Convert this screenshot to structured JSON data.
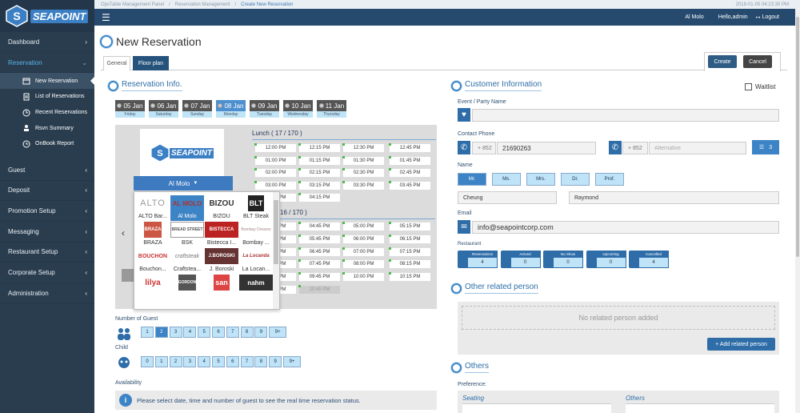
{
  "brand": {
    "logo_text": "SEAPOINT"
  },
  "topbar": {
    "crumbs": [
      "OpsTable Management Panel",
      "Reservation Management",
      "Create New Reservation"
    ],
    "datetime": "2018-01-05 04:23:30 PM"
  },
  "navbar": {
    "restaurant": "Al Molo",
    "greeting": "Hello,admin",
    "logout": "Logout"
  },
  "sidebar": {
    "dashboard": "Dashboard",
    "reservation": "Reservation",
    "sub": [
      "New Reservation",
      "List of Reservations",
      "Recent Reservations",
      "Rsvn Summary",
      "OnBook Report"
    ],
    "items": [
      "Guest",
      "Deposit",
      "Promotion Setup",
      "Messaging",
      "Restaurant Setup",
      "Corporate Setup",
      "Administration"
    ]
  },
  "page": {
    "title": "New Reservation",
    "tabs": [
      "General",
      "Floor plan"
    ],
    "create": "Create",
    "cancel": "Cancel"
  },
  "resinfo": {
    "heading": "Reservation Info."
  },
  "dates": [
    {
      "day": "05 Jan",
      "wd": "Friday"
    },
    {
      "day": "06 Jan",
      "wd": "Saturday"
    },
    {
      "day": "07 Jan",
      "wd": "Sunday"
    },
    {
      "day": "08 Jan",
      "wd": "Monday"
    },
    {
      "day": "09 Jan",
      "wd": "Tuesday"
    },
    {
      "day": "10 Jan",
      "wd": "Wednesday"
    },
    {
      "day": "11 Jan",
      "wd": "Thursday"
    }
  ],
  "restaurant_select": "Al Molo",
  "lunch": {
    "label": "Lunch ( 17 / 170 )",
    "slots": [
      "12:00 PM",
      "12:15 PM",
      "12:30 PM",
      "12:45 PM",
      "01:00 PM",
      "01:15 PM",
      "01:30 PM",
      "01:45 PM",
      "02:00 PM",
      "02:15 PM",
      "02:30 PM",
      "02:45 PM",
      "03:00 PM",
      "03:15 PM",
      "03:30 PM",
      "03:45 PM",
      "04:00 PM",
      "04:15 PM"
    ]
  },
  "dinner": {
    "label": "16 / 170 )",
    "slots": [
      "04:30 PM",
      "04:45 PM",
      "05:00 PM",
      "05:15 PM",
      "05:30 PM",
      "05:45 PM",
      "06:00 PM",
      "06:15 PM",
      "06:30 PM",
      "06:45 PM",
      "07:00 PM",
      "07:15 PM",
      "07:30 PM",
      "07:45 PM",
      "08:00 PM",
      "08:15 PM",
      "09:30 PM",
      "09:45 PM",
      "10:00 PM",
      "10:15 PM",
      "10:30 PM",
      "10:45 PM"
    ]
  },
  "restaurants": [
    {
      "logo": "ALTO",
      "name": "ALTO Bar..."
    },
    {
      "logo": "AL MOLO",
      "name": "Al Molo"
    },
    {
      "logo": "BIZOU",
      "name": "BIZOU"
    },
    {
      "logo": "BLT",
      "name": "BLT Steak"
    },
    {
      "logo": "BRAZA",
      "name": "BRAZA"
    },
    {
      "logo": "BREAD STREET",
      "name": "BSK"
    },
    {
      "logo": "BISTECCA",
      "name": "Bistecca I..."
    },
    {
      "logo": "Bombay Dreams",
      "name": "Bombay ..."
    },
    {
      "logo": "BOUCHON",
      "name": "Bouchon..."
    },
    {
      "logo": "craftsteak",
      "name": "Craftstea..."
    },
    {
      "logo": "J.BOROSKI",
      "name": "J. Boroski"
    },
    {
      "logo": "La Locanda",
      "name": "La Locan..."
    },
    {
      "logo": "lilya",
      "name": ""
    },
    {
      "logo": "GORDON",
      "name": ""
    },
    {
      "logo": "san",
      "name": ""
    },
    {
      "logo": "nahm",
      "name": ""
    }
  ],
  "guests": {
    "label": "Number of Guest",
    "values": [
      "1",
      "2",
      "3",
      "4",
      "5",
      "6",
      "7",
      "8",
      "9",
      "9+"
    ],
    "selected": "2"
  },
  "child": {
    "label": "Child",
    "values": [
      "0",
      "1",
      "2",
      "3",
      "4",
      "5",
      "6",
      "7",
      "8",
      "9",
      "9+"
    ]
  },
  "availability": {
    "label": "Availability",
    "message": "Please select date, time and number of guest to see the real time reservation status."
  },
  "customer": {
    "heading": "Customer Information",
    "waitlist": "Waitlist",
    "event_label": "Event / Party Name",
    "phone_label": "Contact Phone",
    "cc": "+ 852",
    "phone": "21690263",
    "cc2": "+ 852",
    "alt_placeholder": "Alternative",
    "phone_count": "3",
    "name_label": "Name",
    "titles": [
      "Mr.",
      "Ms.",
      "Mrs.",
      "Dr.",
      "Prof."
    ],
    "first": "Cheung",
    "last": "Raymond",
    "email_label": "Email",
    "email": "info@seapointcorp.com",
    "restaurant_label": "Restaurant",
    "stats": [
      {
        "label": "Reservations",
        "value": "4"
      },
      {
        "label": "Arrived",
        "value": "0"
      },
      {
        "label": "No Show",
        "value": "0"
      },
      {
        "label": "Upcoming",
        "value": "0"
      },
      {
        "label": "Cancelled",
        "value": "4"
      }
    ]
  },
  "other_person": {
    "heading": "Other related person",
    "empty": "No related person added",
    "add": "+ Add related person"
  },
  "others": {
    "heading": "Others",
    "pref_label": "Preference:",
    "seating": "Seating",
    "others": "Others"
  }
}
